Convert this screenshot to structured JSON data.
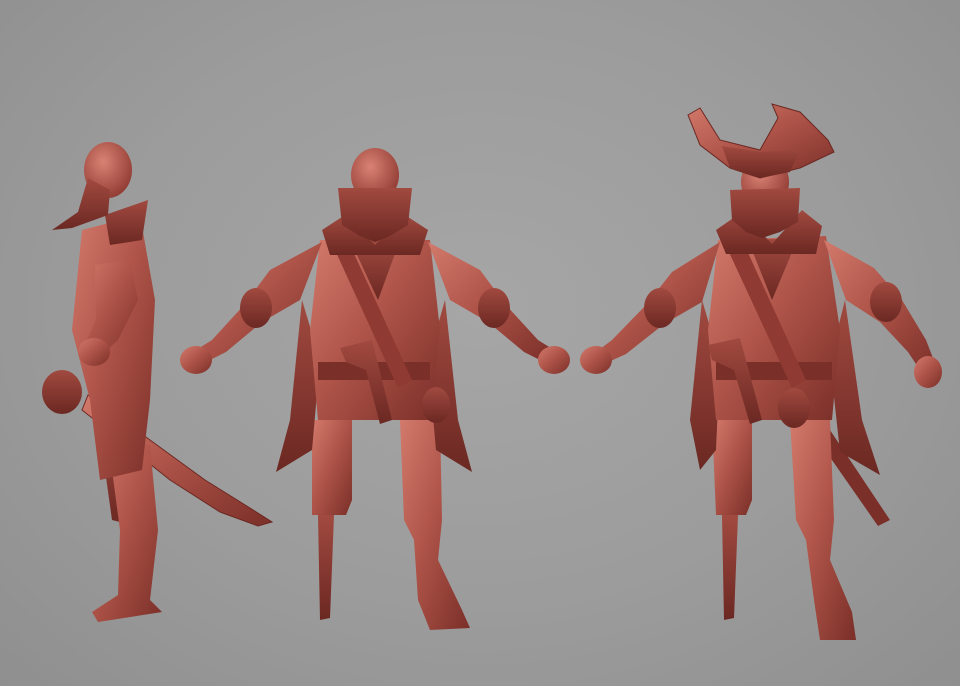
{
  "scene": {
    "background_color": "#9c9c9c",
    "clay_color": "#b0554a",
    "clay_shadow_color": "#7a2f28",
    "clay_highlight_color": "#d27a6c",
    "figures": [
      {
        "view": "side",
        "accessory": "cutlass"
      },
      {
        "view": "front",
        "accessory": "flintlock-pistol"
      },
      {
        "view": "three-quarter",
        "accessory": "tricorn-hat"
      }
    ]
  }
}
